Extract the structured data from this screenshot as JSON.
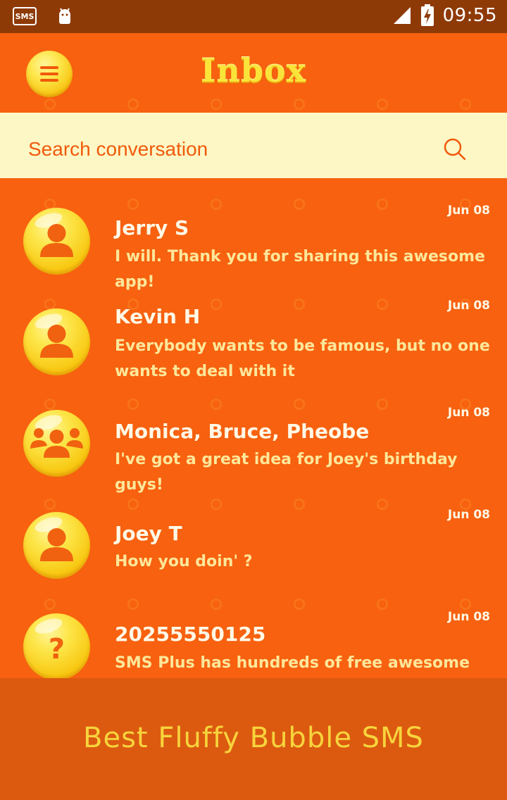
{
  "status_bar": {
    "notif_sms": "SMS",
    "clock": "09:55"
  },
  "app_bar": {
    "title": "Inbox"
  },
  "search": {
    "placeholder": "Search conversation"
  },
  "conversations": [
    {
      "name": "Jerry S",
      "snippet": "I will. Thank you for sharing this awesome app!",
      "date": "Jun 08",
      "avatar": "person-icon"
    },
    {
      "name": "Kevin H",
      "snippet": "Everybody wants to be famous, but no one wants to deal with it",
      "date": "Jun 08",
      "avatar": "person-icon"
    },
    {
      "name": "Monica, Bruce, Pheobe",
      "snippet": "I've got a great idea for Joey's birthday guys!",
      "date": "Jun 08",
      "avatar": "group-icon"
    },
    {
      "name": "Joey T",
      "snippet": "How you doin' ?",
      "date": "Jun 08",
      "avatar": "person-icon"
    },
    {
      "name": "20255550125",
      "snippet": "SMS Plus has hundreds of free awesome themes",
      "date": "Jun 08",
      "avatar": "question-mark"
    }
  ],
  "footer": {
    "text": "Best Fluffy Bubble SMS"
  },
  "colors": {
    "background": "#f7610f",
    "status_bar": "#8e3a07",
    "search_bg": "#fdf7c6",
    "accent_yellow": "#fde64a",
    "footer_bg": "#dc5a10"
  }
}
